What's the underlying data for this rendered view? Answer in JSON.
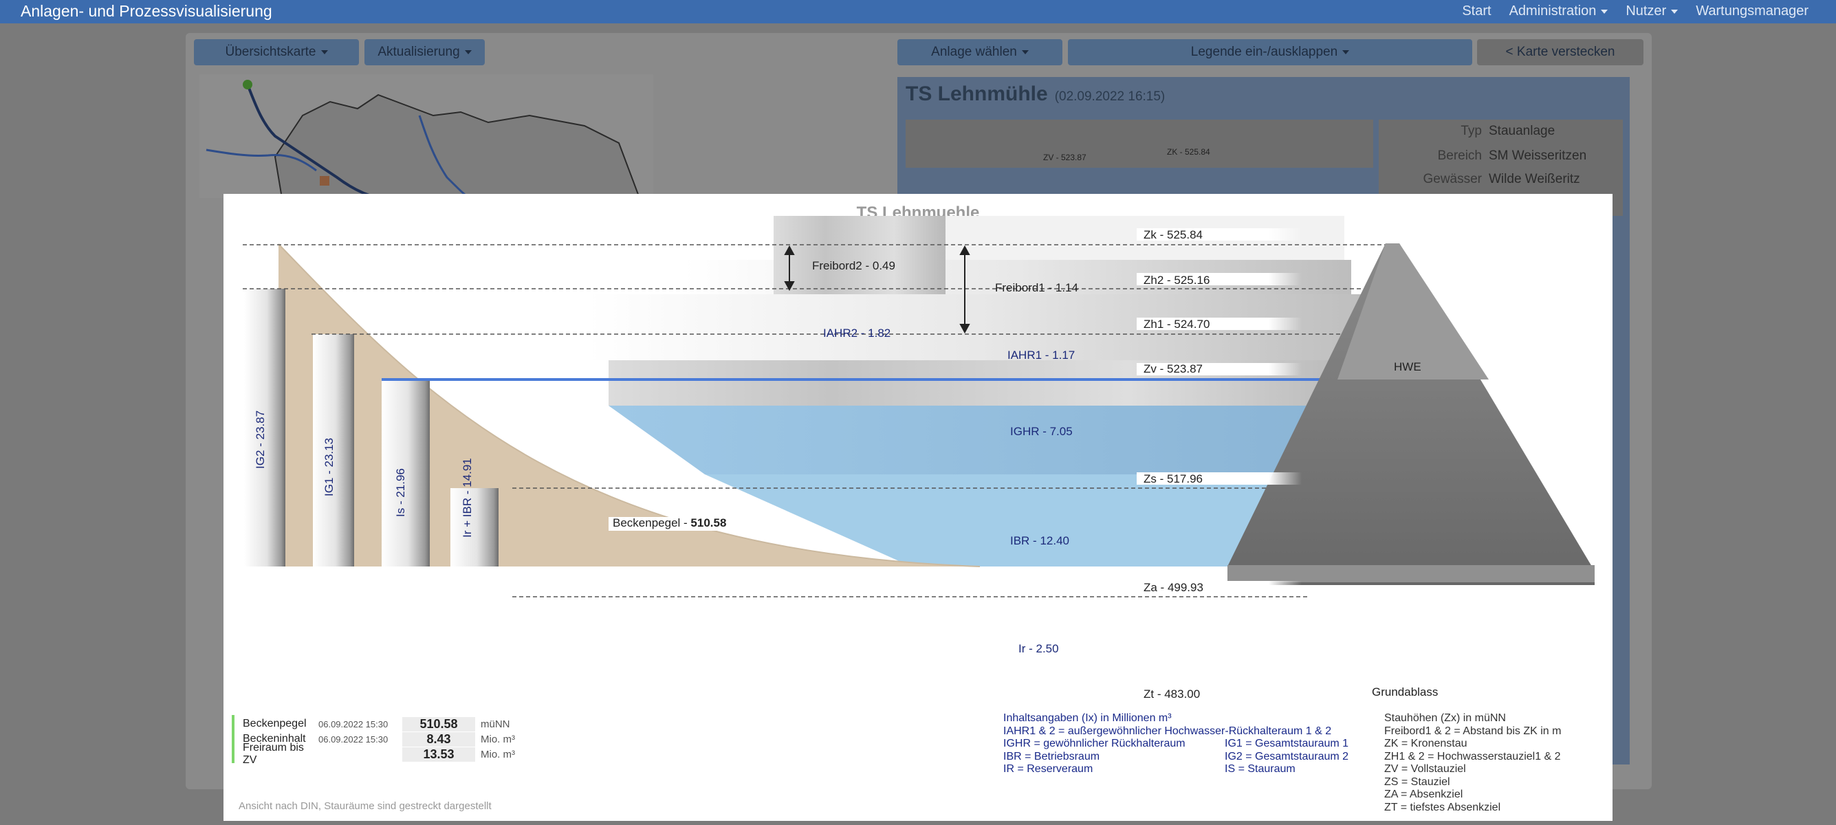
{
  "app": {
    "title": "Anlagen- und Prozessvisualisierung",
    "nav": [
      "Start",
      "Administration",
      "Nutzer",
      "Wartungsmanager"
    ]
  },
  "toolbar": {
    "overview_map": "Übersichtskarte",
    "update": "Aktualisierung",
    "select_plant": "Anlage wählen",
    "legend_toggle": "Legende ein-/ausklappen",
    "hide_map": "< Karte verstecken"
  },
  "info": {
    "title": "TS Lehnmühle",
    "date": "(02.09.2022 16:15)",
    "props": [
      {
        "label": "Typ",
        "value": "Stauanlage"
      },
      {
        "label": "Bereich",
        "value": "SM Weisseritzen"
      },
      {
        "label": "Gewässer",
        "value": "Wilde Weißeritz"
      }
    ],
    "mini_labels": [
      "ZV - 523.87",
      "ZK - 525.84"
    ]
  },
  "modal": {
    "title": "TS Lehnmuehle",
    "footnote": "Ansicht nach DIN, Stauräume sind gestreckt dargestellt",
    "levels": [
      {
        "label": "Zk - 525.84",
        "value": 525.84
      },
      {
        "label": "Zh2 - 525.16",
        "value": 525.16
      },
      {
        "label": "Zh1 - 524.70",
        "value": 524.7
      },
      {
        "label": "Zv - 523.87",
        "value": 523.87
      },
      {
        "label": "Zs - 517.96",
        "value": 517.96
      },
      {
        "label": "Za - 499.93",
        "value": 499.93
      },
      {
        "label": "Zt - 483.00",
        "value": 483.0
      }
    ],
    "volumes": {
      "ig2": "IG2 - 23.87",
      "ig1": "IG1 - 23.13",
      "is": "Is - 21.96",
      "irbr": "Ir + IBR - 14.91",
      "iahr2": "IAHR2 - 1.82",
      "iahr1": "IAHR1 - 1.17",
      "ighr": "IGHR - 7.05",
      "ibr": "IBR - 12.40",
      "ir": "Ir - 2.50"
    },
    "freibord2": "Freibord2 - 0.49",
    "freibord1": "Freibord1 - 1.14",
    "beckenpegel_label": "Beckenpegel -",
    "beckenpegel_value": "510.58",
    "dam_label": "HWE",
    "outlet_label": "Grundablass",
    "stats": [
      {
        "label": "Beckenpegel",
        "date": "06.09.2022 15:30",
        "value": "510.58",
        "unit": "müNN"
      },
      {
        "label": "Beckeninhalt",
        "date": "06.09.2022 15:30",
        "value": "8.43",
        "unit": "Mio. m³"
      },
      {
        "label": "Freiraum bis ZV",
        "date": "",
        "value": "13.53",
        "unit": "Mio. m³"
      }
    ],
    "legend_volumes": {
      "heading": "Inhaltsangaben (Ix) in Millionen m³",
      "line1": "IAHR1 & 2 = außergewöhnlicher Hochwasser-Rückhalteraum 1 & 2",
      "col1": [
        "IGHR = gewöhnlicher Rückhalteraum",
        "IBR = Betriebsraum",
        "IR = Reserveraum"
      ],
      "col2": [
        "IG1 = Gesamtstauraum 1",
        "IG2 = Gesamtstauraum 2",
        "IS = Stauraum"
      ]
    },
    "legend_levels": [
      "Stauhöhen (Zx) in müNN",
      "Freibord1 & 2 = Abstand bis ZK in m",
      "ZK = Kronenstau",
      "ZH1 & 2 = Hochwasserstauziel1 & 2",
      "ZV = Vollstauziel",
      "ZS = Stauziel",
      "ZA = Absenkziel",
      "ZT = tiefstes Absenkziel"
    ]
  }
}
